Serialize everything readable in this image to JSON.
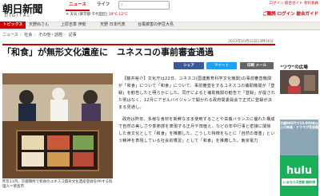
{
  "header": {
    "logo_main": "朝日新聞",
    "logo_sub": "DIGITAL",
    "nav_news": "ニュース",
    "nav_life": "ライフ",
    "search_placeholder": "",
    "nav_links": "ログイン 総合ガイド 有料会員",
    "weather": "天気 (東京都 千代田区)",
    "weather_temp": "19°C 12°C",
    "sub_links": "ご購読 ログイン 総合ガイド"
  },
  "topics": {
    "label": "トピックス",
    "items": [
      "天野尚さん",
      "上原吉季 伊勢",
      "天野 日本代表",
      "台風被害の伊豆大島"
    ]
  },
  "breadcrumb": [
    "ニュース",
    "社会",
    "その他・話題",
    "記事"
  ],
  "article": {
    "datetime": "2013年10月22日13時16分",
    "headline": "「和食」が無形文化遺産に　ユネスコの事前審査通過",
    "share_fb": "シェア",
    "share_tw": "ツイート",
    "share_plus": "印刷 メール",
    "paragraphs": [
      "【藤井裕介】文化庁は22日、ユネスコ(国連教育科学文化機関)の事前審査機関が「和食」について「和食」について、事前審査をするユネスコの補助機関が「登録」を勧告したと明らかにした。同庁によると補助機関の勧告で「登録」が提された例はなく、12月にアゼルバイジャンで開かれる政府間委員会で正式に登録が決まる見通し。",
      "政府は昨年、多様な食材を新鮮なまま使用することや栄養バランスに優れた構成で自然の美しさや季節感を表現する正月や田植え、などの年中行事と密接に関係した食文化として「和食」を推薦した。こうした特徴をもとに「自然の尊重」という精神を表現している社会的慣習」として「和食」を推薦した。東京電力"
    ]
  },
  "photo_caption": "昨年11月、京都御所で和食のユネスコ無形文化遺産登録をPRする料理人＝草島市",
  "sidebar": {
    "heading": "“ツウ”の広場",
    "thumb_text": "",
    "text": "",
    "ad_top_text": "月額980円で10,000本以上の映画・ドラマが見放題",
    "ad_hulu_logo": "hulu",
    "ad_hulu_cta": "いまなら2週間 無料視聴"
  },
  "colors": {
    "accent": "#cc0000",
    "link": "#1a4fa0",
    "hulu": "#1ab05a"
  }
}
